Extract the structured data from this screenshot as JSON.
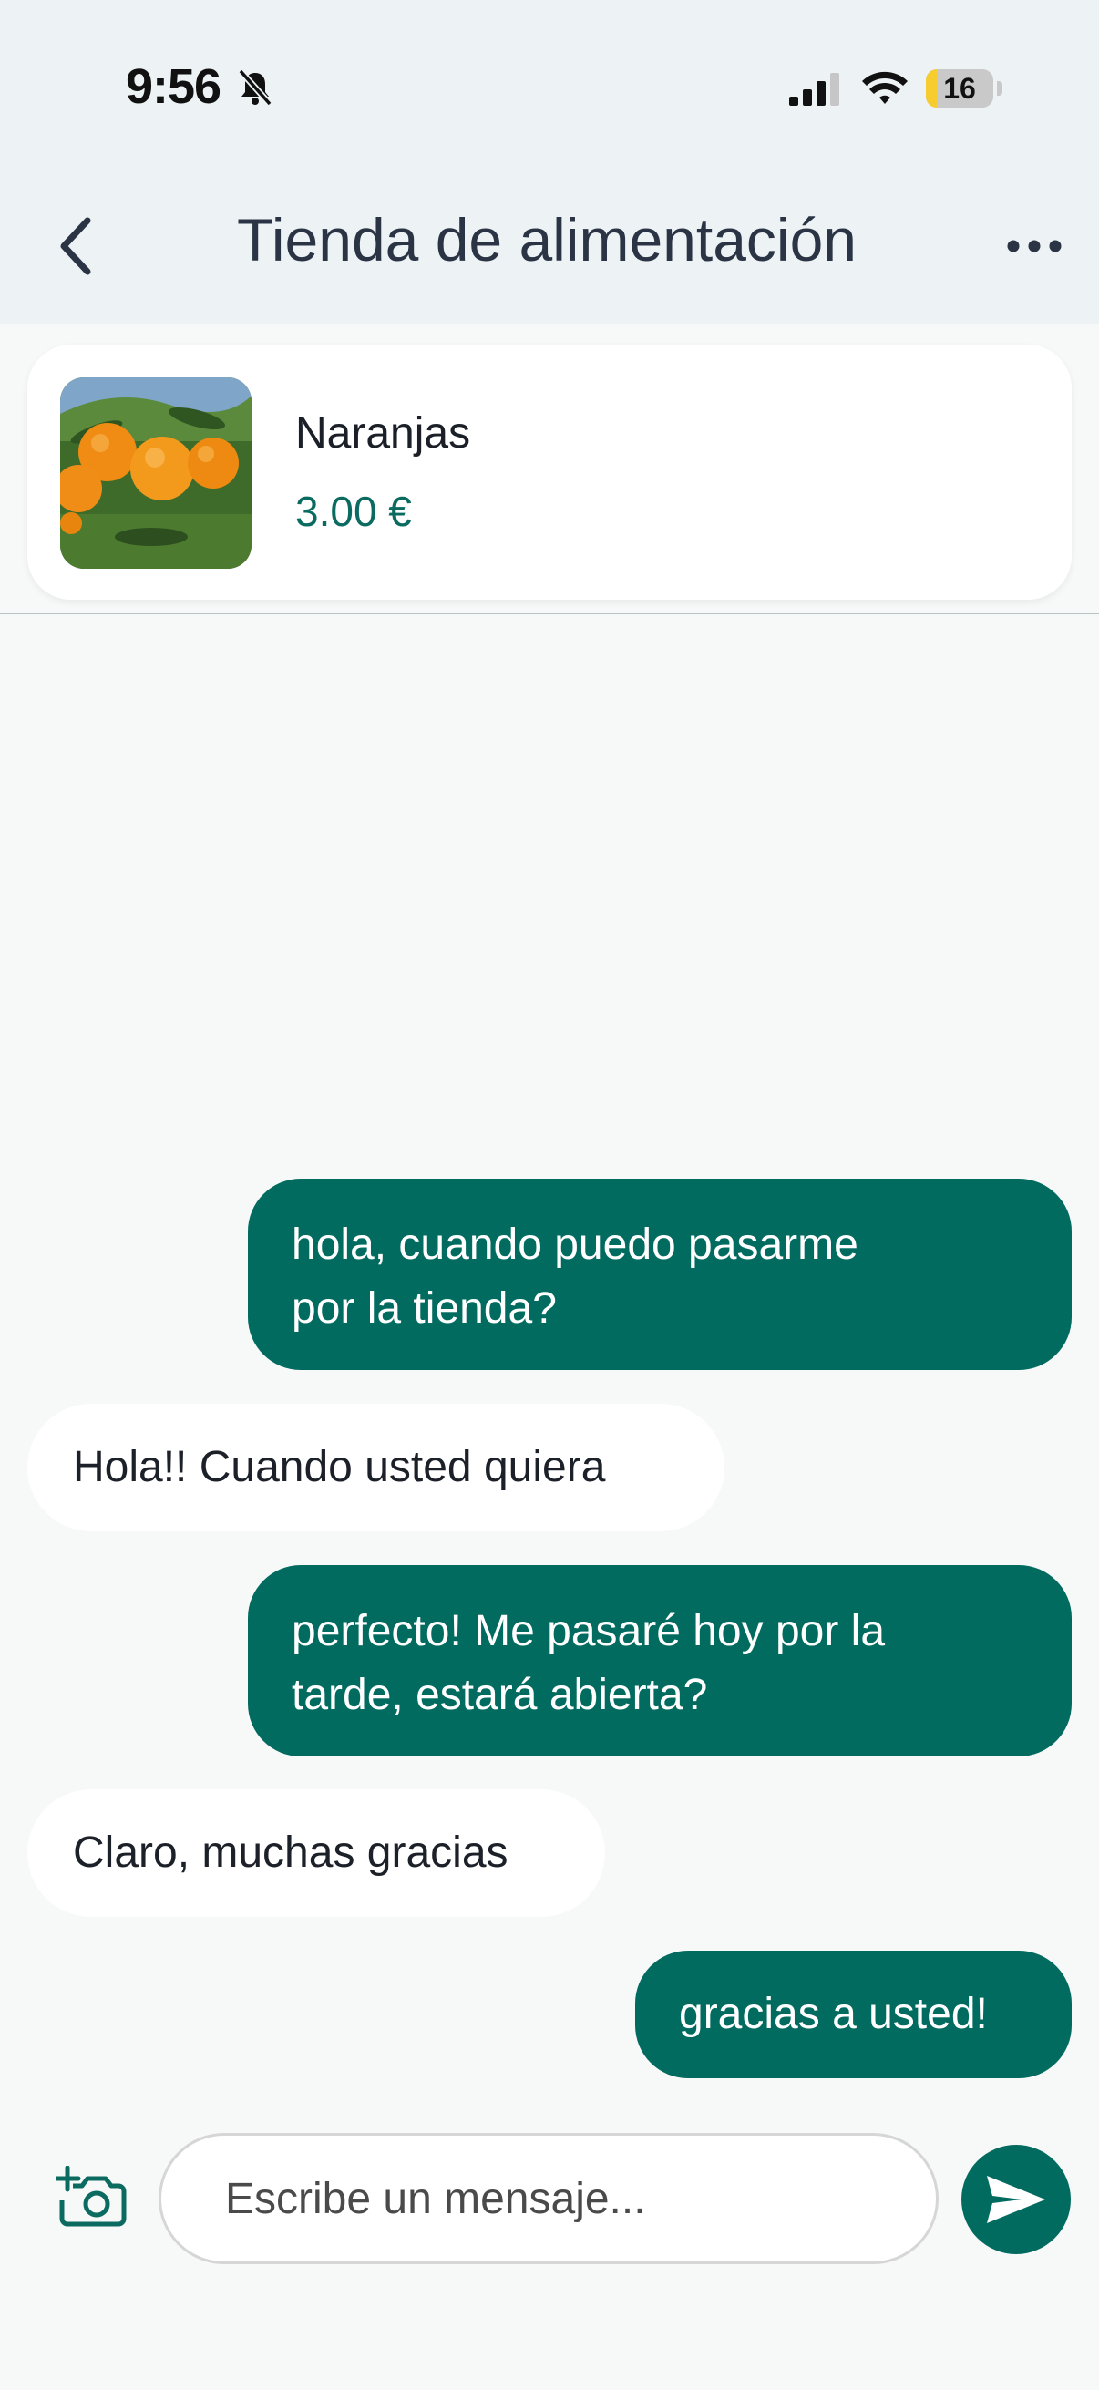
{
  "status_bar": {
    "time": "9:56",
    "battery": "16",
    "battery_level": 0.16
  },
  "header": {
    "title": "Tienda de alimentación"
  },
  "product": {
    "name": "Naranjas",
    "price": "3.00 €"
  },
  "messages": [
    {
      "from": "me",
      "lines": [
        "hola, cuando puedo pasarme",
        "por la tienda?"
      ]
    },
    {
      "from": "other",
      "text": "Hola!! Cuando usted quiera"
    },
    {
      "from": "me",
      "lines": [
        "perfecto! Me pasaré hoy por la",
        "tarde, estará abierta?"
      ]
    },
    {
      "from": "other",
      "text": "Claro, muchas gracias"
    },
    {
      "from": "me",
      "text": "gracias a usted!"
    }
  ],
  "composer": {
    "placeholder": "Escribe un mensaje..."
  },
  "colors": {
    "accent": "#026b60",
    "header_bg": "#edf2f4",
    "chat_bg": "#f7f8f8"
  },
  "icons": {
    "back": "chevron-left-icon",
    "more": "more-horizontal-icon",
    "camera": "camera-plus-icon",
    "send": "send-icon",
    "bell": "bell-slash-icon"
  }
}
